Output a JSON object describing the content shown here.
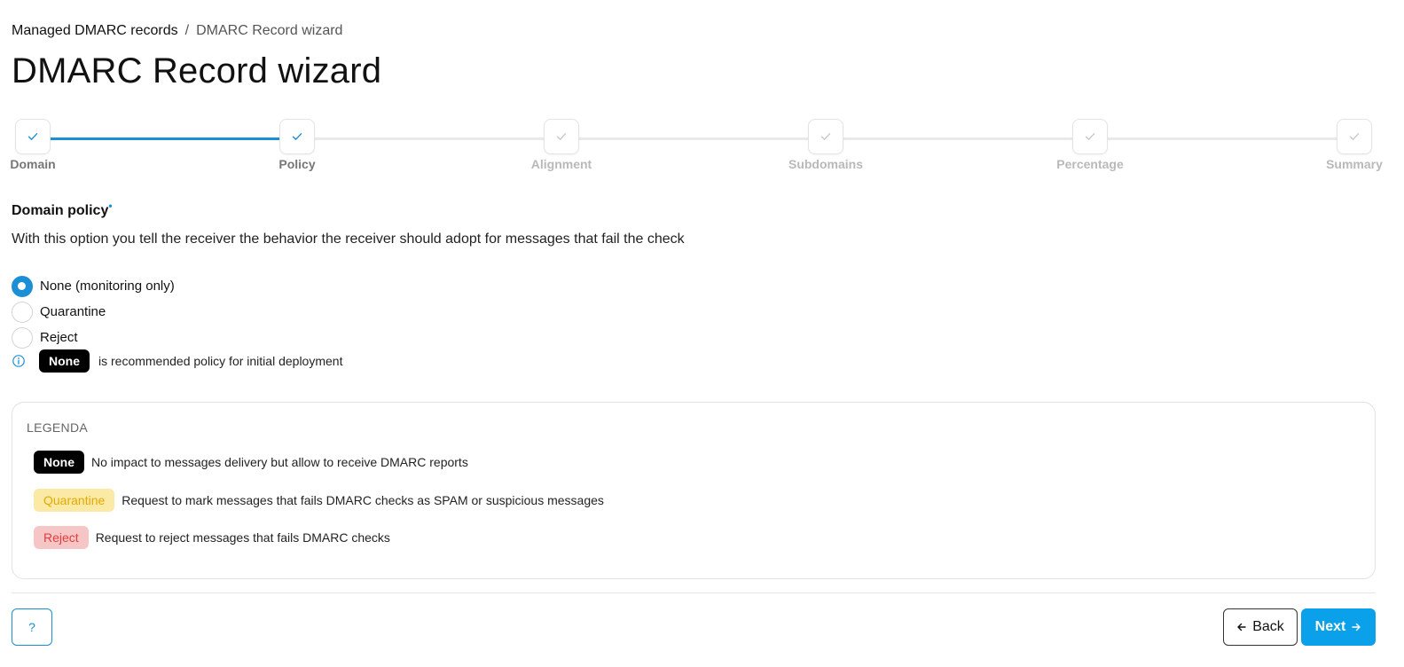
{
  "breadcrumb": {
    "parent": "Managed DMARC records",
    "separator": "/",
    "current": "DMARC Record wizard"
  },
  "page_title": "DMARC Record wizard",
  "steps": [
    {
      "label": "Domain",
      "state": "done"
    },
    {
      "label": "Policy",
      "state": "active"
    },
    {
      "label": "Alignment",
      "state": "inactive"
    },
    {
      "label": "Subdomains",
      "state": "inactive"
    },
    {
      "label": "Percentage",
      "state": "inactive"
    },
    {
      "label": "Summary",
      "state": "inactive"
    }
  ],
  "domain_policy": {
    "title": "Domain policy",
    "required_marker": "•",
    "description": "With this option you tell the receiver the behavior the receiver should adopt for messages that fail the check",
    "options": [
      {
        "label": "None (monitoring only)",
        "checked": true
      },
      {
        "label": "Quarantine",
        "checked": false
      },
      {
        "label": "Reject",
        "checked": false
      }
    ],
    "hint_badge": "None",
    "hint_text": "is recommended policy for initial deployment"
  },
  "legend": {
    "title": "LEGENDA",
    "items": [
      {
        "badge": "None",
        "style": "dark",
        "description": "No impact to messages delivery but allow to receive DMARC reports"
      },
      {
        "badge": "Quarantine",
        "style": "warn",
        "description": "Request to mark messages that fails DMARC checks as SPAM or suspicious messages"
      },
      {
        "badge": "Reject",
        "style": "err",
        "description": "Request to reject messages that fails DMARC checks"
      }
    ]
  },
  "footer": {
    "help_label": "?",
    "back_label": "Back",
    "next_label": "Next"
  },
  "colors": {
    "accent": "#1b8fd6",
    "next_button": "#0aa0ea"
  },
  "icons": {
    "step_check": "check-icon",
    "hint": "info-icon",
    "back": "arrow-left-icon",
    "next": "arrow-right-icon"
  }
}
